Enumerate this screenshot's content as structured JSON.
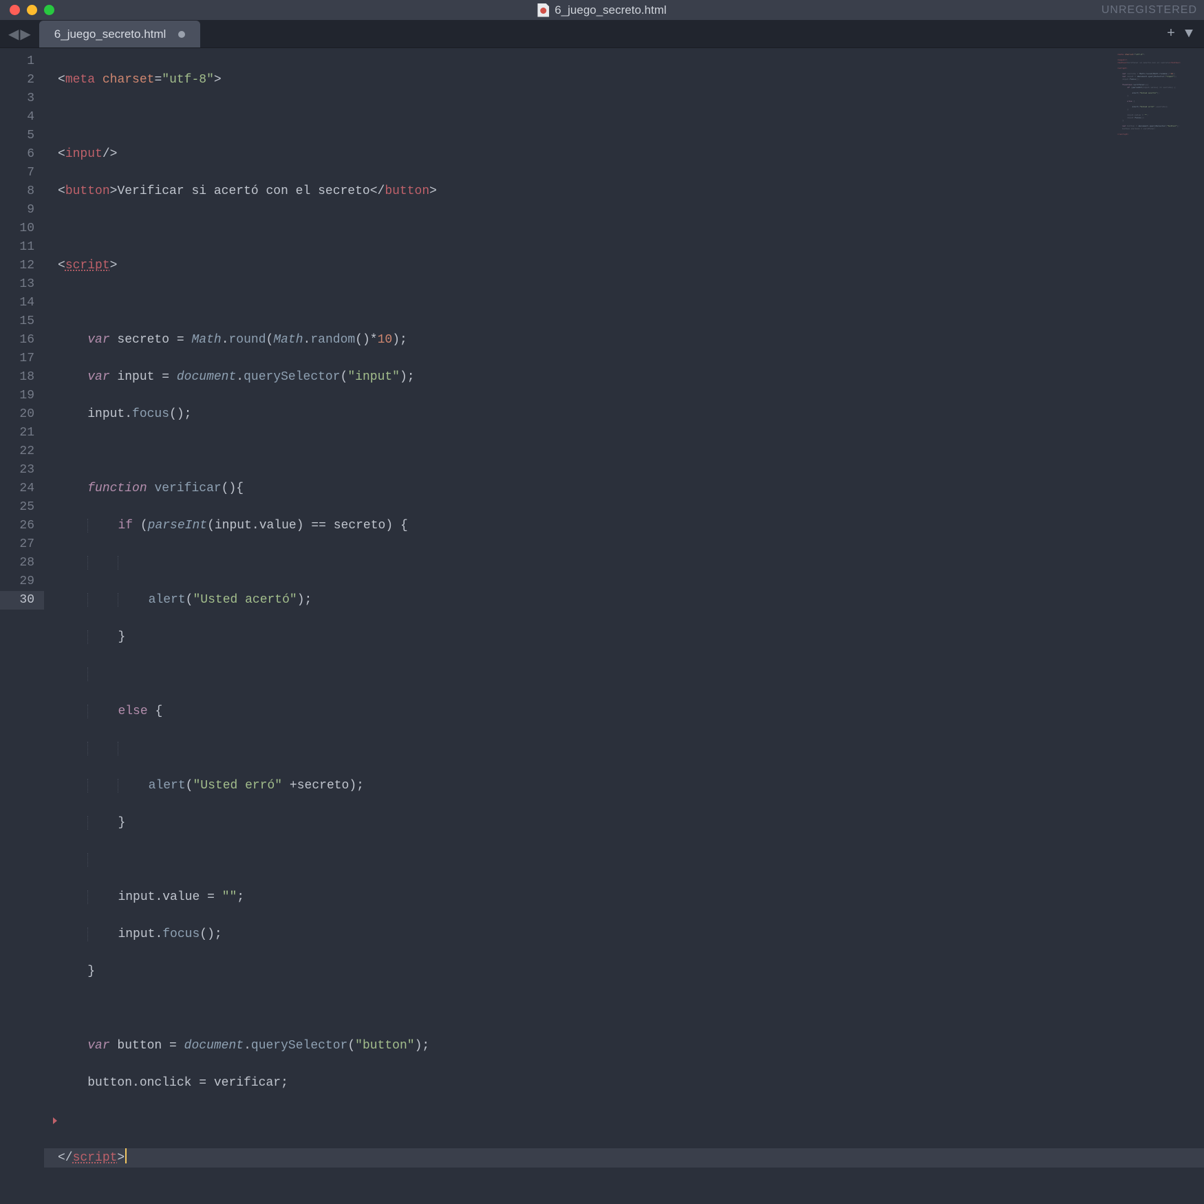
{
  "window": {
    "title": "6_juego_secreto.html",
    "unregistered_label": "UNREGISTERED"
  },
  "tabbar": {
    "nav_back": "◀",
    "nav_forward": "▶",
    "tab_label": "6_juego_secreto.html",
    "add_label": "+",
    "menu_label": "▼"
  },
  "gutter": {
    "lines": [
      "1",
      "2",
      "3",
      "4",
      "5",
      "6",
      "7",
      "8",
      "9",
      "10",
      "11",
      "12",
      "13",
      "14",
      "15",
      "16",
      "17",
      "18",
      "19",
      "20",
      "21",
      "22",
      "23",
      "24",
      "25",
      "26",
      "27",
      "28",
      "29",
      "30"
    ],
    "current_line_index": 29
  },
  "code": {
    "l1": {
      "t0": "<",
      "t1": "meta",
      "t2": " ",
      "t3": "charset",
      "t4": "=",
      "t5": "\"utf-8\"",
      "t6": ">"
    },
    "l3": {
      "t0": "<",
      "t1": "input",
      "t2": "/>"
    },
    "l4": {
      "t0": "<",
      "t1": "button",
      "t2": ">",
      "t3": "Verificar si acertó con el secreto",
      "t4": "</",
      "t5": "button",
      "t6": ">"
    },
    "l6": {
      "t0": "<",
      "t1": "script",
      "t2": ">"
    },
    "l8": {
      "t0": "var",
      "t1": " secreto ",
      "t2": "=",
      "t3": " ",
      "t4": "Math",
      "t5": ".",
      "t6": "round",
      "t7": "(",
      "t8": "Math",
      "t9": ".",
      "t10": "random",
      "t11": "()",
      "t12": "*",
      "t13": "10",
      "t14": ");"
    },
    "l9": {
      "t0": "var",
      "t1": " input ",
      "t2": "=",
      "t3": " ",
      "t4": "document",
      "t5": ".",
      "t6": "querySelector",
      "t7": "(",
      "t8": "\"input\"",
      "t9": ");"
    },
    "l10": {
      "t0": "input.",
      "t1": "focus",
      "t2": "();"
    },
    "l12": {
      "t0": "function",
      "t1": " ",
      "t2": "verificar",
      "t3": "(){"
    },
    "l13": {
      "t0": "if",
      "t1": " (",
      "t2": "parseInt",
      "t3": "(input.value) ",
      "t4": "==",
      "t5": " secreto) {"
    },
    "l15": {
      "t0": "alert",
      "t1": "(",
      "t2": "\"Usted acertó\"",
      "t3": ");"
    },
    "l16": {
      "t0": "}"
    },
    "l18": {
      "t0": "else",
      "t1": " {"
    },
    "l20": {
      "t0": "alert",
      "t1": "(",
      "t2": "\"Usted erró\"",
      "t3": " ",
      "t4": "+",
      "t5": "secreto);"
    },
    "l21": {
      "t0": "}"
    },
    "l23": {
      "t0": "input.value ",
      "t1": "=",
      "t2": " ",
      "t3": "\"\"",
      "t4": ";"
    },
    "l24": {
      "t0": "input.",
      "t1": "focus",
      "t2": "();"
    },
    "l25": {
      "t0": "}"
    },
    "l27": {
      "t0": "var",
      "t1": " button ",
      "t2": "=",
      "t3": " ",
      "t4": "document",
      "t5": ".",
      "t6": "querySelector",
      "t7": "(",
      "t8": "\"button\"",
      "t9": ");"
    },
    "l28": {
      "t0": "button.onclick ",
      "t1": "=",
      "t2": " verificar;"
    },
    "l30": {
      "t0": "</",
      "t1": "script",
      "t2": ">"
    }
  }
}
